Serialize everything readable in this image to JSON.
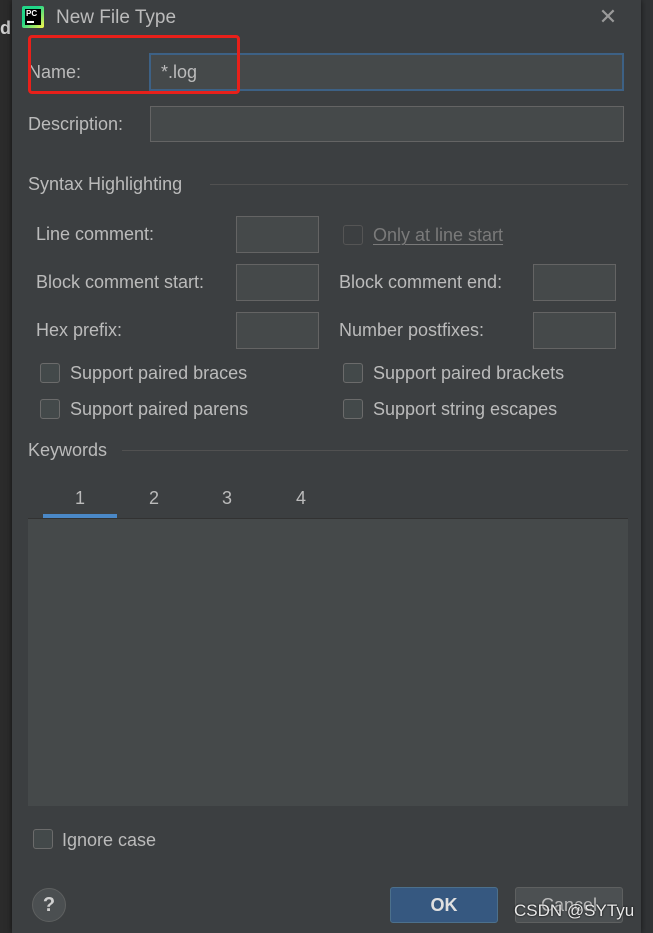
{
  "window": {
    "title": "New File Type",
    "app_logo_text": "PC"
  },
  "form": {
    "name_label": "Name:",
    "name_value": "*.log",
    "description_label": "Description:",
    "description_value": ""
  },
  "syntax": {
    "section_title": "Syntax Highlighting",
    "line_comment_label": "Line comment:",
    "only_at_line_start_label": "Only at line start",
    "block_comment_start_label": "Block comment start:",
    "block_comment_end_label": "Block comment end:",
    "hex_prefix_label": "Hex prefix:",
    "number_postfixes_label": "Number postfixes:",
    "checkboxes": {
      "paired_braces": "Support paired braces",
      "paired_brackets": "Support paired brackets",
      "paired_parens": "Support paired parens",
      "string_escapes": "Support string escapes"
    }
  },
  "keywords": {
    "section_title": "Keywords",
    "tabs": [
      "1",
      "2",
      "3",
      "4"
    ],
    "active_tab": "1"
  },
  "footer": {
    "ignore_case_label": "Ignore case",
    "help_label": "?",
    "ok_label": "OK",
    "cancel_label": "Cancel"
  },
  "overlay": {
    "watermark": "CSDN @SYTyu",
    "highlight_color": "#e8201a"
  },
  "colors": {
    "dialog_bg": "#3c3f41",
    "field_bg": "#45494a",
    "accent": "#4a88c7",
    "ok_button": "#365880"
  }
}
